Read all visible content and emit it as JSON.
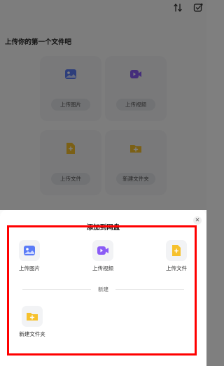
{
  "background": {
    "heading": "上传你的第一个文件吧",
    "tiles": [
      {
        "label": "上传图片",
        "icon": "image-icon",
        "color": "#5b7cf7"
      },
      {
        "label": "上传视频",
        "icon": "video-icon",
        "color": "#8b5cf6"
      },
      {
        "label": "上传文件",
        "icon": "file-icon",
        "color": "#f6c12d"
      },
      {
        "label": "新建文件夹",
        "icon": "folder-icon",
        "color": "#f6c12d"
      }
    ],
    "top_icons": [
      "sort-icon",
      "check-edit-icon"
    ]
  },
  "sheet": {
    "title": "添加到网盘",
    "close_icon": "close-icon",
    "actions": [
      {
        "label": "上传图片",
        "icon": "image-icon"
      },
      {
        "label": "上传视频",
        "icon": "video-icon"
      },
      {
        "label": "上传文件",
        "icon": "file-icon"
      }
    ],
    "section_label": "新建",
    "new_actions": [
      {
        "label": "新建文件夹",
        "icon": "folder-icon"
      }
    ],
    "highlight_color": "#ff0000"
  }
}
